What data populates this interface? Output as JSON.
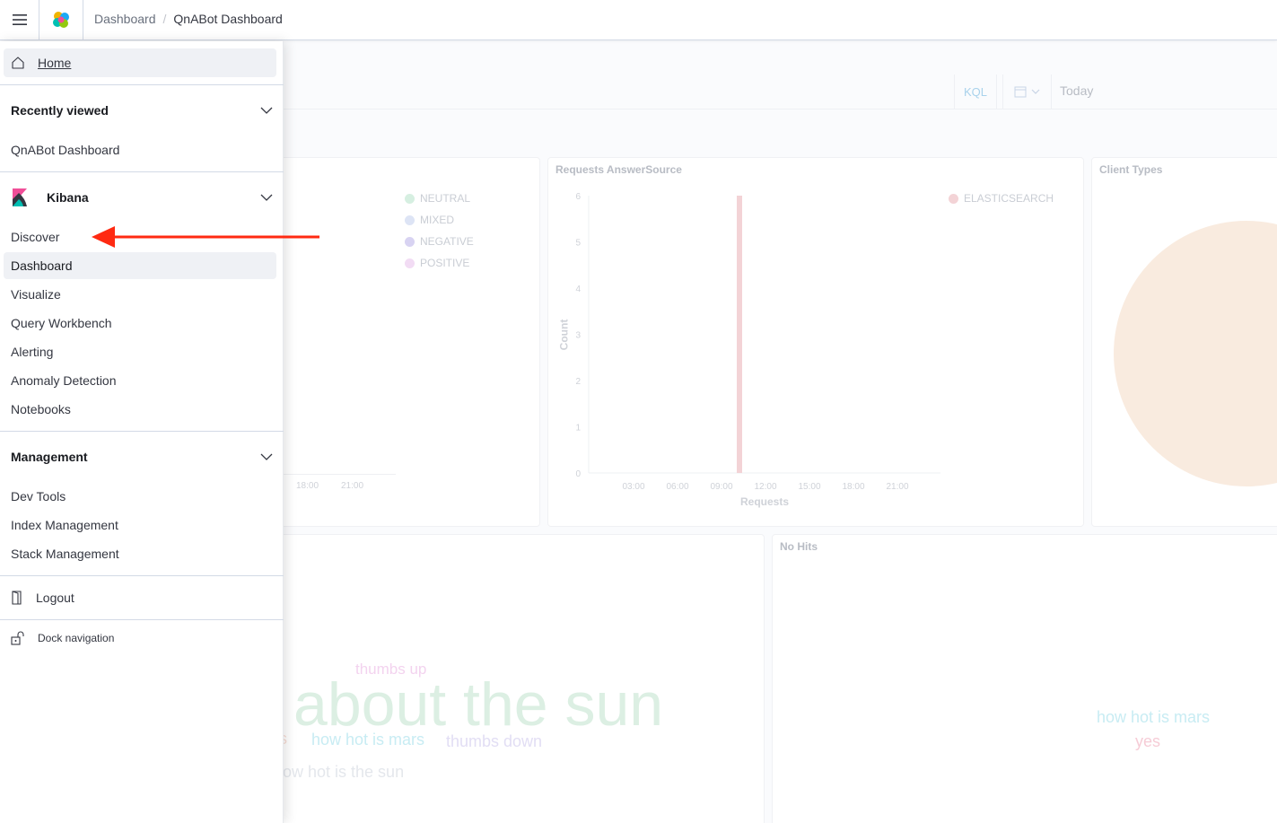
{
  "header": {
    "breadcrumbs": [
      "Dashboard",
      "QnABot Dashboard"
    ]
  },
  "query_bar": {
    "language_label": "KQL",
    "date_label": "Today"
  },
  "panels": {
    "sentiment": {
      "legend": [
        "NEUTRAL",
        "MIXED",
        "NEGATIVE",
        "POSITIVE"
      ],
      "legend_colors": [
        "#b9e4cc",
        "#c8d3f0",
        "#bcb5e8",
        "#e8c4ec"
      ],
      "x_ticks": [
        "18:00",
        "21:00"
      ]
    },
    "answer_source": {
      "title": "Requests AnswerSource",
      "legend": [
        "ELASTICSEARCH"
      ],
      "legend_color": "#e6a6ab",
      "y_ticks": [
        "6",
        "5",
        "4",
        "3",
        "2",
        "1",
        "0"
      ],
      "x_ticks": [
        "03:00",
        "06:00",
        "09:00",
        "12:00",
        "15:00",
        "18:00",
        "21:00"
      ],
      "ylabel": "Count",
      "xlabel": "Requests"
    },
    "client_types": {
      "title": "Client Types"
    },
    "utterances_cloud": {
      "words": [
        "thumbs up",
        "about the sun",
        "s",
        "how hot is mars",
        "thumbs down",
        "ow hot is the sun"
      ]
    },
    "no_hits": {
      "title": "No Hits",
      "words": [
        "how hot is mars",
        "yes"
      ]
    }
  },
  "chart_data": {
    "type": "bar",
    "title": "Requests AnswerSource",
    "xlabel": "Requests",
    "ylabel": "Count",
    "x": [
      "03:00",
      "06:00",
      "09:00",
      "12:00",
      "15:00",
      "18:00",
      "21:00"
    ],
    "ylim": [
      0,
      6
    ],
    "series": [
      {
        "name": "ELASTICSEARCH",
        "values": [
          0,
          0,
          6,
          0,
          0,
          0,
          0
        ]
      }
    ],
    "legend": "top-right"
  },
  "nav": {
    "home_label": "Home",
    "recently_viewed": {
      "title": "Recently viewed",
      "items": [
        "QnABot Dashboard"
      ]
    },
    "kibana": {
      "title": "Kibana",
      "items": [
        "Discover",
        "Dashboard",
        "Visualize",
        "Query Workbench",
        "Alerting",
        "Anomaly Detection",
        "Notebooks"
      ]
    },
    "management": {
      "title": "Management",
      "items": [
        "Dev Tools",
        "Index Management",
        "Stack Management"
      ]
    },
    "logout_label": "Logout",
    "dock_label": "Dock navigation"
  },
  "colors": {
    "annotation_arrow": "#ff2a12",
    "kibana_pink": "#f04e98",
    "kibana_teal": "#00bfb3"
  }
}
